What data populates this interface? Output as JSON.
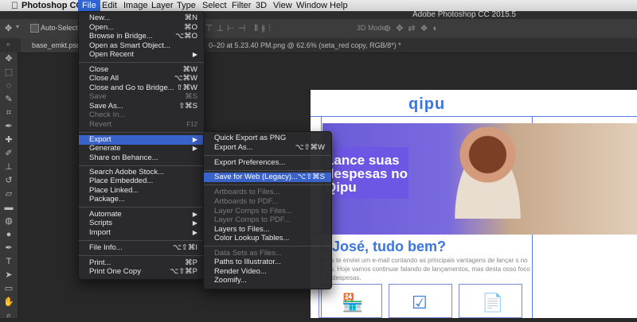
{
  "menubar": {
    "apple": "",
    "items": [
      {
        "label": "Photoshop CC"
      },
      {
        "label": "File"
      },
      {
        "label": "Edit"
      },
      {
        "label": "Image"
      },
      {
        "label": "Layer"
      },
      {
        "label": "Type"
      },
      {
        "label": "Select"
      },
      {
        "label": "Filter"
      },
      {
        "label": "3D"
      },
      {
        "label": "View"
      },
      {
        "label": "Window"
      },
      {
        "label": "Help"
      }
    ]
  },
  "window_title": "Adobe Photoshop CC 2015.5",
  "options": {
    "auto_select": "Auto-Select:",
    "mode_3d": "3D Mode:"
  },
  "tabs": {
    "tab1": "base_emkt.psd @",
    "tab2": "0–20 at 5.23.40 PM.png @ 62.6% (seta_red copy, RGB/8*) *"
  },
  "file_menu": {
    "items": [
      {
        "label": "New...",
        "shortcut": "⌘N"
      },
      {
        "label": "Open...",
        "shortcut": "⌘O"
      },
      {
        "label": "Browse in Bridge...",
        "shortcut": "⌥⌘O"
      },
      {
        "label": "Open as Smart Object...",
        "shortcut": ""
      },
      {
        "label": "Open Recent",
        "shortcut": "▶"
      },
      {
        "label": "Close",
        "shortcut": "⌘W"
      },
      {
        "label": "Close All",
        "shortcut": "⌥⌘W"
      },
      {
        "label": "Close and Go to Bridge...",
        "shortcut": "⇧⌘W"
      },
      {
        "label": "Save",
        "shortcut": "⌘S"
      },
      {
        "label": "Save As...",
        "shortcut": "⇧⌘S"
      },
      {
        "label": "Check In...",
        "shortcut": ""
      },
      {
        "label": "Revert",
        "shortcut": "F12"
      },
      {
        "label": "Export",
        "shortcut": "▶"
      },
      {
        "label": "Generate",
        "shortcut": "▶"
      },
      {
        "label": "Share on Behance...",
        "shortcut": ""
      },
      {
        "label": "Search Adobe Stock...",
        "shortcut": ""
      },
      {
        "label": "Place Embedded...",
        "shortcut": ""
      },
      {
        "label": "Place Linked...",
        "shortcut": ""
      },
      {
        "label": "Package...",
        "shortcut": ""
      },
      {
        "label": "Automate",
        "shortcut": "▶"
      },
      {
        "label": "Scripts",
        "shortcut": "▶"
      },
      {
        "label": "Import",
        "shortcut": "▶"
      },
      {
        "label": "File Info...",
        "shortcut": "⌥⇧⌘I"
      },
      {
        "label": "Print...",
        "shortcut": "⌘P"
      },
      {
        "label": "Print One Copy",
        "shortcut": "⌥⇧⌘P"
      }
    ]
  },
  "export_menu": {
    "items": [
      {
        "label": "Quick Export as PNG",
        "shortcut": ""
      },
      {
        "label": "Export As...",
        "shortcut": "⌥⇧⌘W"
      },
      {
        "label": "Export Preferences...",
        "shortcut": ""
      },
      {
        "label": "Save for Web (Legacy)...",
        "shortcut": "⌥⇧⌘S"
      },
      {
        "label": "Artboards to Files...",
        "shortcut": ""
      },
      {
        "label": "Artboards to PDF...",
        "shortcut": ""
      },
      {
        "label": "Layer Comps to Files...",
        "shortcut": ""
      },
      {
        "label": "Layer Comps to PDF...",
        "shortcut": ""
      },
      {
        "label": "Layers to Files...",
        "shortcut": ""
      },
      {
        "label": "Color Lookup Tables...",
        "shortcut": ""
      },
      {
        "label": "Data Sets as Files...",
        "shortcut": ""
      },
      {
        "label": "Paths to Illustrator...",
        "shortcut": ""
      },
      {
        "label": "Render Video...",
        "shortcut": ""
      },
      {
        "label": "Zoomify...",
        "shortcut": ""
      }
    ]
  },
  "document": {
    "logo": "qipu",
    "hero_text": "Lance suas despesas no Qipu",
    "greeting": "a José, tudo bem?",
    "body": "atrás te enviei um e-mail contando as principais vantagens de lançar s no Qipu. Hoje vamos continuar falando de lançamentos, mas desta osso foco são despesas."
  },
  "colors": {
    "accent": "#3a63c9",
    "brand": "#3b76e0",
    "hero": "#6b57e4"
  }
}
